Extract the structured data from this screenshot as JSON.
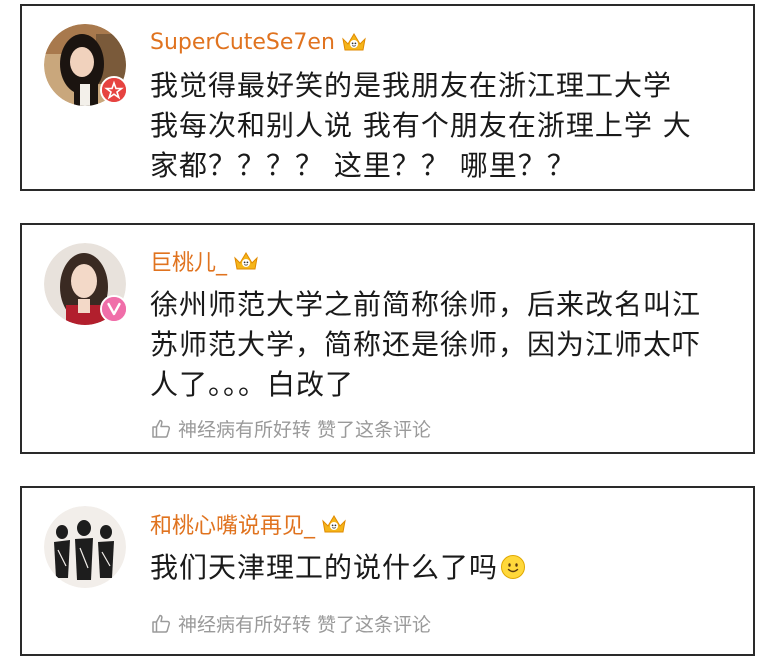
{
  "comments": [
    {
      "username": "SuperCuteSe7en",
      "avatar_icon": "avatar-woman-dark-hair",
      "badge_icon": "red-star-badge-icon",
      "vip_icon": "crown-vip-icon",
      "lines": [
        "我觉得最好笑的是我朋友在浙江理工大学",
        "我每次和别人说 我有个朋友在浙理上学 大",
        "家都？？？？ 这里？？ 哪里？？"
      ],
      "like_text": ""
    },
    {
      "username": "巨桃儿_",
      "avatar_icon": "avatar-woman-long-hair",
      "badge_icon": "pink-v-badge-icon",
      "vip_icon": "crown-vip-icon",
      "lines": [
        "徐州师范大学之前简称徐师，后来改名叫江",
        "苏师范大学，简称还是徐师，因为江师太吓",
        "人了。。。白改了"
      ],
      "like_text": "神经病有所好转 赞了这条评论"
    },
    {
      "username": "和桃心嘴说再见_",
      "avatar_icon": "avatar-sketch-figures",
      "badge_icon": "",
      "vip_icon": "crown-vip-icon",
      "lines": [
        "我们天津理工的说什么了吗"
      ],
      "emoji": "smile-emoji-icon",
      "like_text": "神经病有所好转 赞了这条评论"
    }
  ],
  "colors": {
    "username": "#e0731f",
    "body_text": "#1a1a1a",
    "like_text": "#9a9a9a",
    "border": "#2a2a2a",
    "badge_red": "#e64340",
    "badge_pink": "#f06ea9",
    "crown_gold": "#f5b51a"
  }
}
